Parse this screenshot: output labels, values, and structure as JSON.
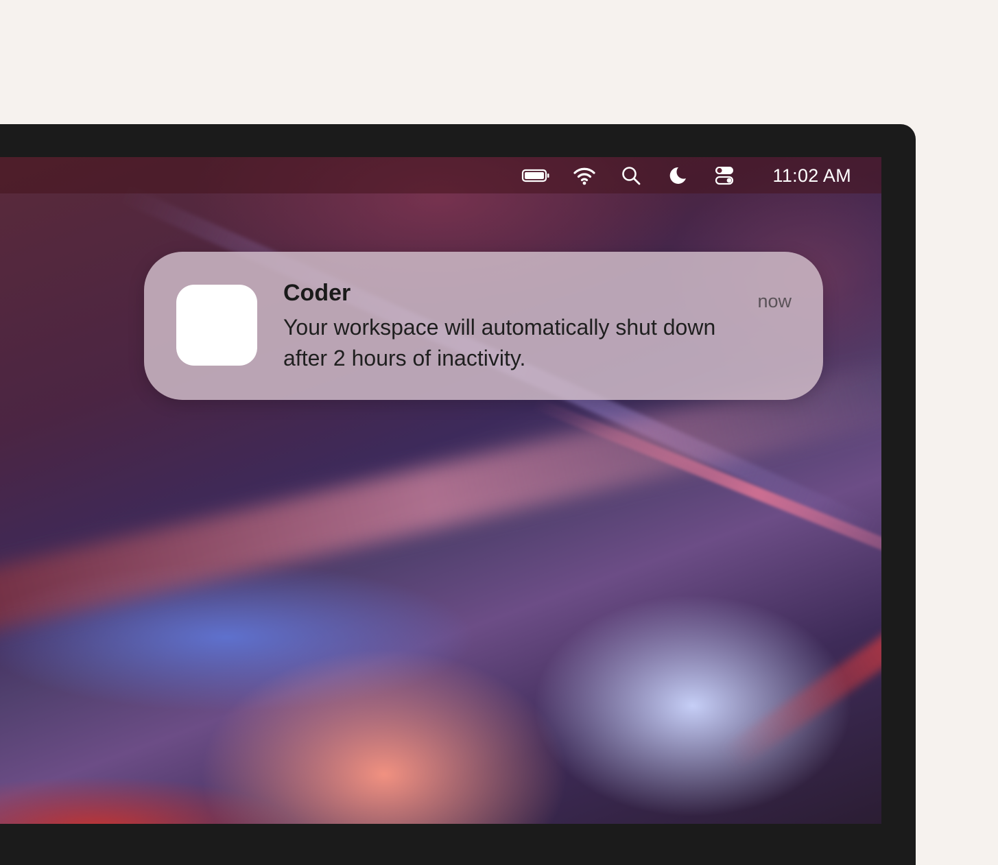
{
  "menubar": {
    "icons": [
      "battery-icon",
      "wifi-icon",
      "search-icon",
      "do-not-disturb-moon-icon",
      "control-center-icon"
    ],
    "clock": "11:02 AM"
  },
  "notification": {
    "app_name": "Coder",
    "message": "Your workspace will automatically shut down after 2 hours of inactivity.",
    "time": "now",
    "icon": "coder-app-icon"
  },
  "colors": {
    "page_background": "#f6f2ee",
    "bezel": "#1b1b1b",
    "notification_background": "#cdb9c6",
    "menubar_text": "#ffffff"
  }
}
